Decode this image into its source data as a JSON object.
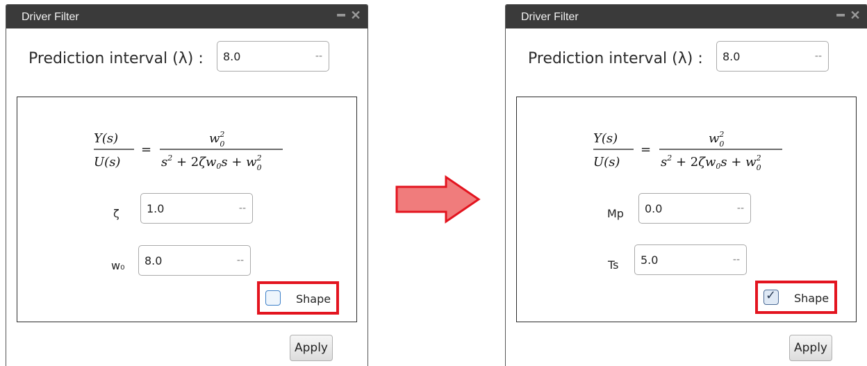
{
  "panels": [
    {
      "title": "Driver Filter",
      "minimize_icon": "minimize-icon",
      "close_icon": "close-icon",
      "prediction": {
        "label": "Prediction interval (λ) :",
        "value": "8.0",
        "unit": "--"
      },
      "params": [
        {
          "label": "ζ",
          "value": "1.0",
          "unit": "--"
        },
        {
          "label": "w₀",
          "value": "8.0",
          "unit": "--"
        }
      ],
      "shape": {
        "label": "Shape",
        "checked": false
      },
      "apply_label": "Apply"
    },
    {
      "title": "Driver Filter",
      "minimize_icon": "minimize-icon",
      "close_icon": "close-icon",
      "prediction": {
        "label": "Prediction interval (λ) :",
        "value": "8.0",
        "unit": "--"
      },
      "params": [
        {
          "label": "Mp",
          "value": "0.0",
          "unit": "--"
        },
        {
          "label": "Ts",
          "value": "5.0",
          "unit": "--"
        }
      ],
      "shape": {
        "label": "Shape",
        "checked": true,
        "check_icon": "checkmark-icon"
      },
      "apply_label": "Apply"
    }
  ],
  "formula": {
    "lhs_num": "Y(s)",
    "lhs_den": "U(s)",
    "equals": "=",
    "rhs_num": "w",
    "rhs_den": "s",
    "sup": "2",
    "sub": "0"
  },
  "arrow": {
    "icon": "right-arrow-icon",
    "fill": "#f07c7c",
    "stroke": "#e3141f"
  },
  "colors": {
    "titlebar": "#3a3a3a",
    "highlight": "#e3141f",
    "checkbox_border": "#3c7fc8"
  }
}
